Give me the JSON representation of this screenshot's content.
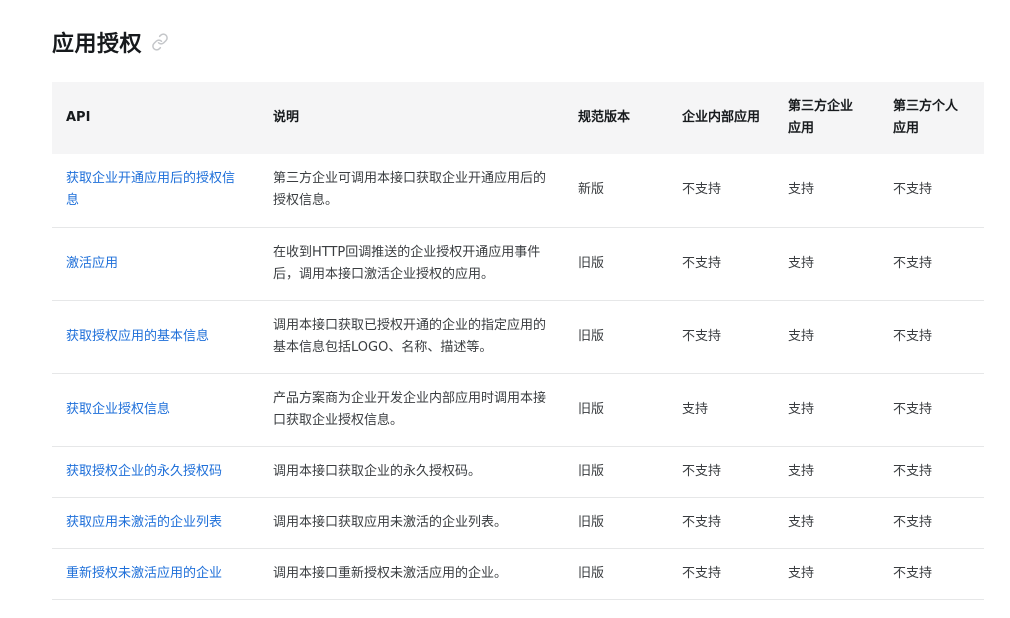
{
  "page": {
    "title": "应用授权",
    "anchor_icon": "link-icon"
  },
  "table": {
    "headers": [
      "API",
      "说明",
      "规范版本",
      "企业内部应用",
      "第三方企业应用",
      "第三方个人应用"
    ],
    "rows": [
      {
        "api": "获取企业开通应用后的授权信息",
        "desc": "第三方企业可调用本接口获取企业开通应用后的授权信息。",
        "version": "新版",
        "internal": "不支持",
        "third_corp": "支持",
        "third_personal": "不支持"
      },
      {
        "api": "激活应用",
        "desc": "在收到HTTP回调推送的企业授权开通应用事件后，调用本接口激活企业授权的应用。",
        "version": "旧版",
        "internal": "不支持",
        "third_corp": "支持",
        "third_personal": "不支持"
      },
      {
        "api": "获取授权应用的基本信息",
        "desc": "调用本接口获取已授权开通的企业的指定应用的基本信息包括LOGO、名称、描述等。",
        "version": "旧版",
        "internal": "不支持",
        "third_corp": "支持",
        "third_personal": "不支持"
      },
      {
        "api": "获取企业授权信息",
        "desc": "产品方案商为企业开发企业内部应用时调用本接口获取企业授权信息。",
        "version": "旧版",
        "internal": "支持",
        "third_corp": "支持",
        "third_personal": "不支持"
      },
      {
        "api": "获取授权企业的永久授权码",
        "desc": "调用本接口获取企业的永久授权码。",
        "version": "旧版",
        "internal": "不支持",
        "third_corp": "支持",
        "third_personal": "不支持"
      },
      {
        "api": "获取应用未激活的企业列表",
        "desc": "调用本接口获取应用未激活的企业列表。",
        "version": "旧版",
        "internal": "不支持",
        "third_corp": "支持",
        "third_personal": "不支持"
      },
      {
        "api": "重新授权未激活应用的企业",
        "desc": "调用本接口重新授权未激活应用的企业。",
        "version": "旧版",
        "internal": "不支持",
        "third_corp": "支持",
        "third_personal": "不支持"
      }
    ]
  },
  "colors": {
    "link": "#1e6fd9",
    "header_bg": "#f5f5f6",
    "border": "#e6e7e8",
    "icon": "#c4c6c9"
  }
}
